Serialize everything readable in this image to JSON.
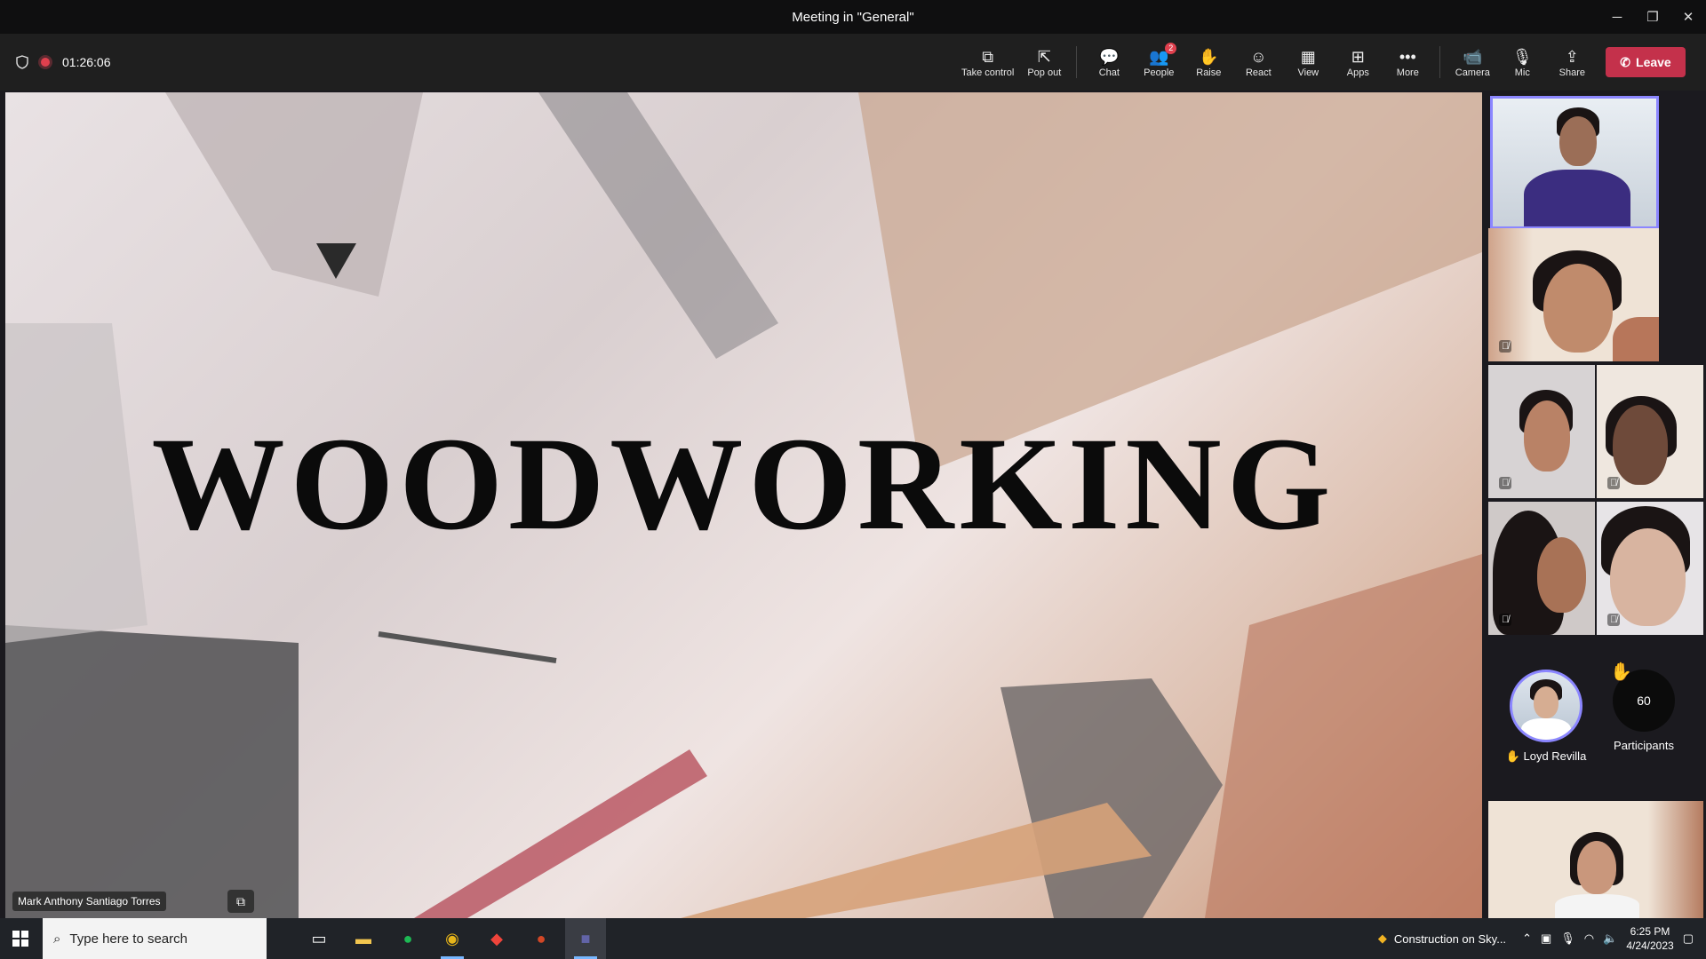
{
  "window": {
    "title": "Meeting in \"General\"",
    "minimize": "─",
    "restore": "❐",
    "close": "✕"
  },
  "meeting": {
    "timer": "01:26:06",
    "shield_icon": "shield-icon",
    "recording_icon": "recording-dot"
  },
  "toolbar": {
    "items": [
      {
        "label": "Take control",
        "icon": "⧉"
      },
      {
        "label": "Pop out",
        "icon": "⇱"
      },
      {
        "label": "Chat",
        "icon": "💬"
      },
      {
        "label": "People",
        "icon": "👥",
        "badge": "2"
      },
      {
        "label": "Raise",
        "icon": "✋"
      },
      {
        "label": "React",
        "icon": "☺"
      },
      {
        "label": "View",
        "icon": "▦"
      },
      {
        "label": "Apps",
        "icon": "⊞"
      },
      {
        "label": "More",
        "icon": "•••"
      },
      {
        "label": "Camera",
        "icon": "📹"
      },
      {
        "label": "Mic",
        "icon": "🎙"
      },
      {
        "label": "Share",
        "icon": "⇪"
      }
    ],
    "leave_label": "Leave",
    "leave_icon": "✆"
  },
  "stage": {
    "slide_title": "WOODWORKING",
    "presenter_name": "Mark Anthony Santiago Torres",
    "camera_icon": "⧉"
  },
  "participants": {
    "raised_name": "Loyd Revilla",
    "raised_icon": "✋",
    "count": "60",
    "count_label": "Participants",
    "mute_icon": "🎙̸"
  },
  "taskbar": {
    "search_placeholder": "Type here to search",
    "weather": "Construction on Sky...",
    "time": "6:25 PM",
    "date": "4/24/2023"
  },
  "colors": {
    "leave": "#c4314b",
    "accent": "#8b86ff",
    "recording": "#e0404e"
  }
}
